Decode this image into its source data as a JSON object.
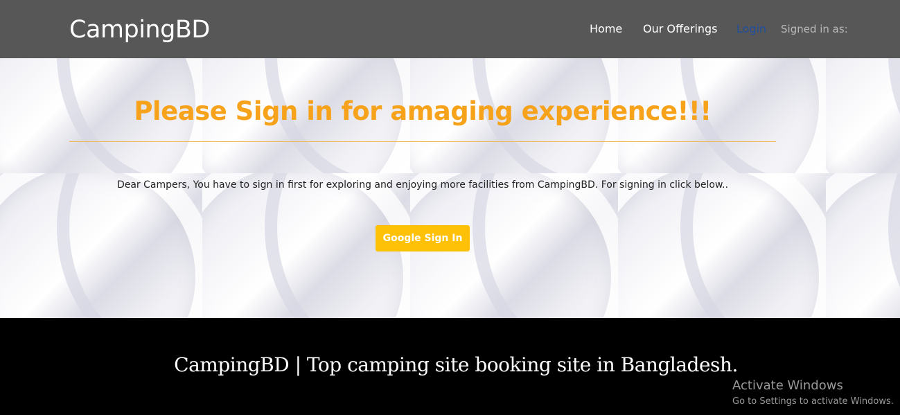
{
  "header": {
    "brand": "CampingBD",
    "nav": {
      "home": "Home",
      "offerings": "Our Offerings",
      "login": "Login",
      "signed_in": "Signed in as:"
    }
  },
  "main": {
    "title": "Please Sign in for amaging experience!!!",
    "message": "Dear Campers, You have to sign in first for exploring and enjoying more facilities from CampingBD. For signing in click below..",
    "google_button": "Google Sign In"
  },
  "footer": {
    "text": "CampingBD | Top camping site booking site in Bangladesh."
  },
  "watermark": {
    "title": "Activate Windows",
    "subtitle": "Go to Settings to activate Windows."
  },
  "colors": {
    "navbar": "#575757",
    "title_accent": "#f7a21b",
    "button": "#ffc107",
    "login_link": "#1f4f9e",
    "footer": "#000000"
  }
}
